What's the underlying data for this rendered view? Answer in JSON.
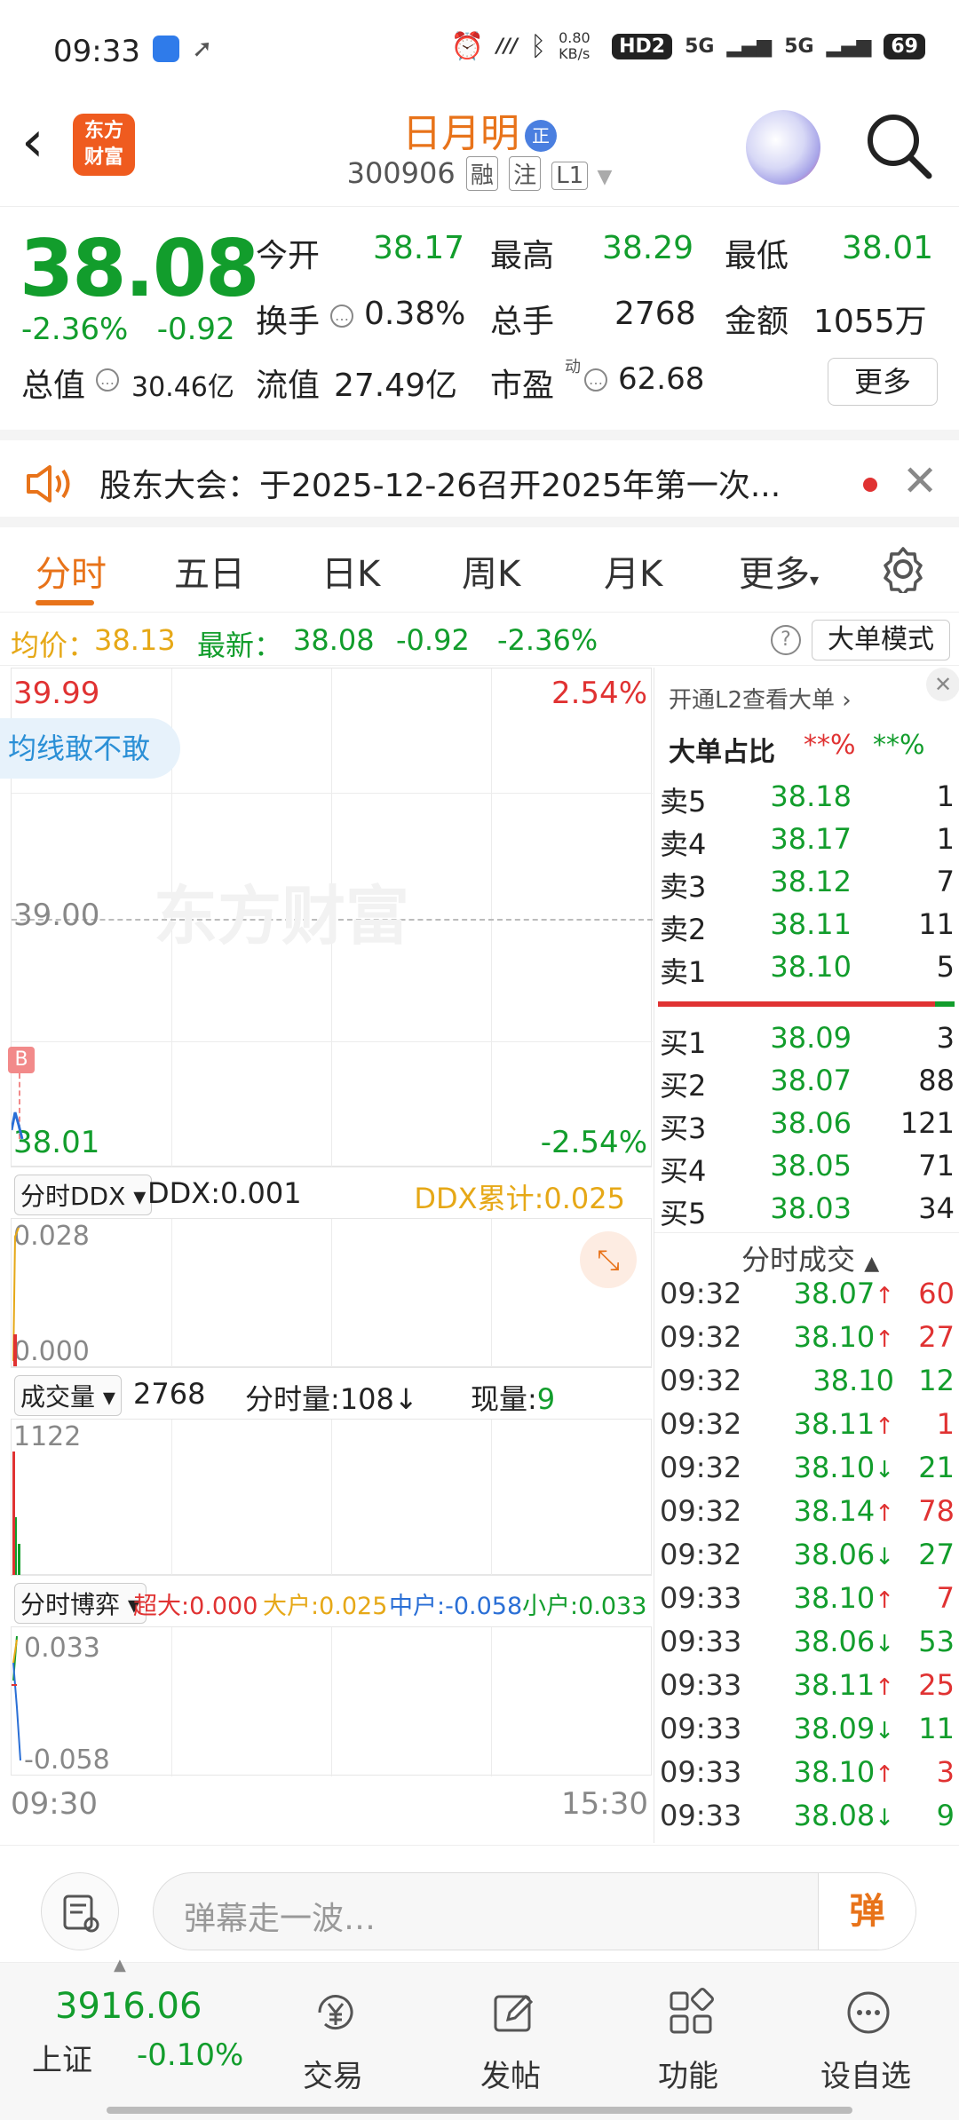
{
  "status_bar": {
    "time": "09:33",
    "net_speed": "0.80 KB/s",
    "network": "5G",
    "network2": "5G",
    "hd": "HD2",
    "battery": "69"
  },
  "header": {
    "logo_text": "东方\n财富",
    "stock_name": "日月明",
    "badge": "正",
    "stock_code": "300906",
    "tag_margin": "融",
    "tag_attention": "注",
    "tag_level": "L1"
  },
  "quote": {
    "price": "38.08",
    "change_pct": "-2.36%",
    "change_amt": "-0.92",
    "open_label": "今开",
    "open": "38.17",
    "high_label": "最高",
    "high": "38.29",
    "low_label": "最低",
    "low": "38.01",
    "turnover_label": "换手",
    "turnover": "0.38%",
    "volume_label": "总手",
    "volume": "2768",
    "amount_label": "金额",
    "amount": "1055万",
    "mktcap_label": "总值",
    "mktcap": "30.46亿",
    "float_label": "流值",
    "float_cap": "27.49亿",
    "pe_label": "市盈",
    "pe_sup": "动",
    "pe": "62.68",
    "more": "更多"
  },
  "notice": {
    "text": "股东大会：于2025-12-26召开2025年第一次..."
  },
  "tabs": [
    "分时",
    "五日",
    "日K",
    "周K",
    "月K",
    "更多"
  ],
  "info_line": {
    "avg_label": "均价：",
    "avg": "38.13",
    "latest_label": "最新：",
    "latest": "38.08",
    "chg": "-0.92",
    "pct": "-2.36%",
    "big_mode": "大单模式"
  },
  "chart": {
    "top_price": "39.99",
    "top_pct": "2.54%",
    "mid_price": "39.00",
    "bottom_price": "38.01",
    "bottom_pct": "-2.54%",
    "bubble": "均线敢不敢",
    "marker": "B",
    "watermark": "东方财富",
    "ddx_select": "分时DDX",
    "ddx_value": "DDX:0.001",
    "ddx_sum": "DDX累计:0.025",
    "ddx_top": "0.028",
    "ddx_bottom": "0.000",
    "vol_select": "成交量",
    "vol_total": "2768",
    "vol_minute": "分时量:108",
    "vol_minute_arrow": "↓",
    "vol_now_label": "现量:",
    "vol_now": "9",
    "vol_top": "1122",
    "game_select": "分时博弈",
    "super": "超大:0.000",
    "large": "大户:0.025",
    "mid": "中户:-0.058",
    "small": "小户:0.033",
    "game_top": "0.033",
    "game_bottom": "-0.058",
    "time_start": "09:30",
    "time_end": "15:30"
  },
  "order_book": {
    "l2_link": "开通L2查看大单",
    "big_ratio_label": "大单占比",
    "big_ratio_red": "**%",
    "big_ratio_green": "**%",
    "asks": [
      {
        "label": "卖5",
        "price": "38.18",
        "qty": "1"
      },
      {
        "label": "卖4",
        "price": "38.17",
        "qty": "1"
      },
      {
        "label": "卖3",
        "price": "38.12",
        "qty": "7"
      },
      {
        "label": "卖2",
        "price": "38.11",
        "qty": "11"
      },
      {
        "label": "卖1",
        "price": "38.10",
        "qty": "5"
      }
    ],
    "bids": [
      {
        "label": "买1",
        "price": "38.09",
        "qty": "3"
      },
      {
        "label": "买2",
        "price": "38.07",
        "qty": "88"
      },
      {
        "label": "买3",
        "price": "38.06",
        "qty": "121"
      },
      {
        "label": "买4",
        "price": "38.05",
        "qty": "71"
      },
      {
        "label": "买5",
        "price": "38.03",
        "qty": "34"
      }
    ],
    "trades_title": "分时成交",
    "trades": [
      {
        "time": "09:32",
        "price": "38.07",
        "dir": "↑",
        "qty": "60",
        "color": "red"
      },
      {
        "time": "09:32",
        "price": "38.10",
        "dir": "↑",
        "qty": "27",
        "color": "red"
      },
      {
        "time": "09:32",
        "price": "38.10",
        "dir": "",
        "qty": "12",
        "color": "green"
      },
      {
        "time": "09:32",
        "price": "38.11",
        "dir": "↑",
        "qty": "1",
        "color": "red"
      },
      {
        "time": "09:32",
        "price": "38.10",
        "dir": "↓",
        "qty": "21",
        "color": "green"
      },
      {
        "time": "09:32",
        "price": "38.14",
        "dir": "↑",
        "qty": "78",
        "color": "red"
      },
      {
        "time": "09:32",
        "price": "38.06",
        "dir": "↓",
        "qty": "27",
        "color": "green"
      },
      {
        "time": "09:33",
        "price": "38.10",
        "dir": "↑",
        "qty": "7",
        "color": "red"
      },
      {
        "time": "09:33",
        "price": "38.06",
        "dir": "↓",
        "qty": "53",
        "color": "green"
      },
      {
        "time": "09:33",
        "price": "38.11",
        "dir": "↑",
        "qty": "25",
        "color": "red"
      },
      {
        "time": "09:33",
        "price": "38.09",
        "dir": "↓",
        "qty": "11",
        "color": "green"
      },
      {
        "time": "09:33",
        "price": "38.10",
        "dir": "↑",
        "qty": "3",
        "color": "red"
      },
      {
        "time": "09:33",
        "price": "38.08",
        "dir": "↓",
        "qty": "9",
        "color": "green"
      }
    ]
  },
  "danmu": {
    "placeholder": "弹幕走一波…",
    "button": "弹"
  },
  "bottom_nav": {
    "index_value": "3916.06",
    "index_name": "上证",
    "index_chg": "-0.10%",
    "items": [
      {
        "label": "交易",
        "icon": "yen-cycle-icon"
      },
      {
        "label": "发帖",
        "icon": "edit-icon"
      },
      {
        "label": "功能",
        "icon": "grid-icon"
      },
      {
        "label": "设自选",
        "icon": "more-dots-icon"
      }
    ]
  },
  "colors": {
    "up": "#e03232",
    "down": "#129d2c",
    "accent": "#e8731a",
    "avg_line": "#e6a817"
  }
}
